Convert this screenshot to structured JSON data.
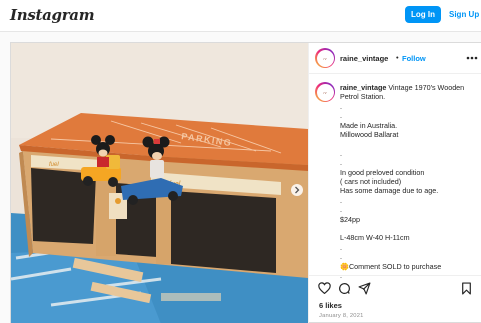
{
  "header": {
    "logo_text": "Instagram",
    "login_label": "Log In",
    "signup_label": "Sign Up"
  },
  "post": {
    "username": "raine_vintage",
    "separator": "•",
    "follow_label": "Follow",
    "caption_lines": [
      "Vintage 1970's Wooden",
      "Petrol Station.",
      ".",
      ".",
      "Made in Australia.",
      "Millowood Ballarat",
      "",
      ".",
      ".",
      "In good preloved condition",
      "( cars not included)",
      "Has some damage due to age.",
      ".",
      ".",
      "$24pp",
      "",
      "L-48cm W-40 H-11cm",
      ".",
      ".",
      "🌼Comment SOLD to purchase",
      "."
    ],
    "likes": "6 likes",
    "date": "January 8, 2021",
    "photo_signs": {
      "roof_sign": "PARKING",
      "fuel_left": "fuel",
      "fuel_right": "fuel"
    }
  },
  "icons": {
    "heart": "heart-icon",
    "comment": "comment-icon",
    "share": "send-icon",
    "save": "bookmark-icon",
    "more": "more-horizontal-icon",
    "next": "chevron-right-icon"
  },
  "colors": {
    "accent": "#0095f6",
    "roof": "#e07a3c",
    "floor": "#3f8fc4"
  }
}
